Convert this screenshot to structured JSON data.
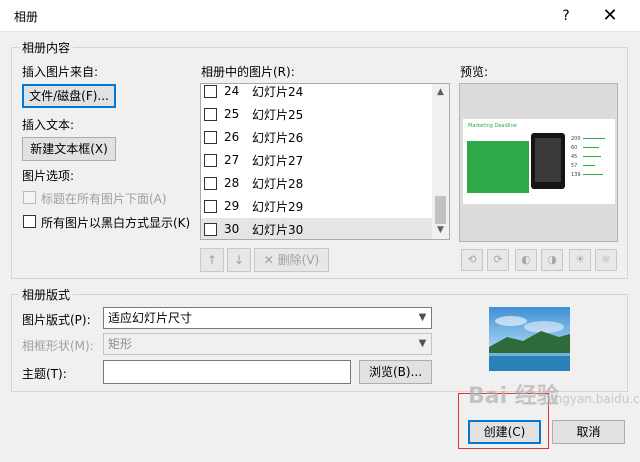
{
  "window": {
    "title": "相册",
    "help": "?",
    "close": "✕"
  },
  "album_content": {
    "group_label": "相册内容",
    "insert_from_label": "插入图片来自:",
    "file_disk_button": "文件/磁盘(F)...",
    "insert_text_label": "插入文本:",
    "new_textbox_button": "新建文本框(X)",
    "picture_options_label": "图片选项:",
    "option_captions": "标题在所有图片下面(A)",
    "option_bw": "所有图片以黑白方式显示(K)",
    "pictures_label": "相册中的图片(R):",
    "pictures": [
      {
        "num": "24",
        "name": "幻灯片24",
        "selected": false
      },
      {
        "num": "25",
        "name": "幻灯片25",
        "selected": false
      },
      {
        "num": "26",
        "name": "幻灯片26",
        "selected": false
      },
      {
        "num": "27",
        "name": "幻灯片27",
        "selected": false
      },
      {
        "num": "28",
        "name": "幻灯片28",
        "selected": false
      },
      {
        "num": "29",
        "name": "幻灯片29",
        "selected": false
      },
      {
        "num": "30",
        "name": "幻灯片30",
        "selected": true
      }
    ],
    "move_up": "↑",
    "move_down": "↓",
    "remove_button": "删除(V)",
    "preview_label": "预览:",
    "preview_slide": {
      "heading": "Marketing Deadline",
      "numbers": [
        "200",
        "60",
        "45",
        "57",
        "139"
      ]
    }
  },
  "layout": {
    "group_label": "相册版式",
    "picture_layout_label": "图片版式(P):",
    "picture_layout_value": "适应幻灯片尺寸",
    "frame_shape_label": "相框形状(M):",
    "frame_shape_value": "矩形",
    "theme_label": "主题(T):",
    "theme_value": "",
    "browse_button": "浏览(B)..."
  },
  "footer": {
    "create_button": "创建(C)",
    "cancel_button": "取消"
  },
  "watermark": {
    "main": "Bai 经验",
    "sub": "jingyan.baidu.com"
  },
  "colors": {
    "accent": "#0078d7",
    "highlight": "#e03030",
    "slide_green": "#2fa84a"
  }
}
